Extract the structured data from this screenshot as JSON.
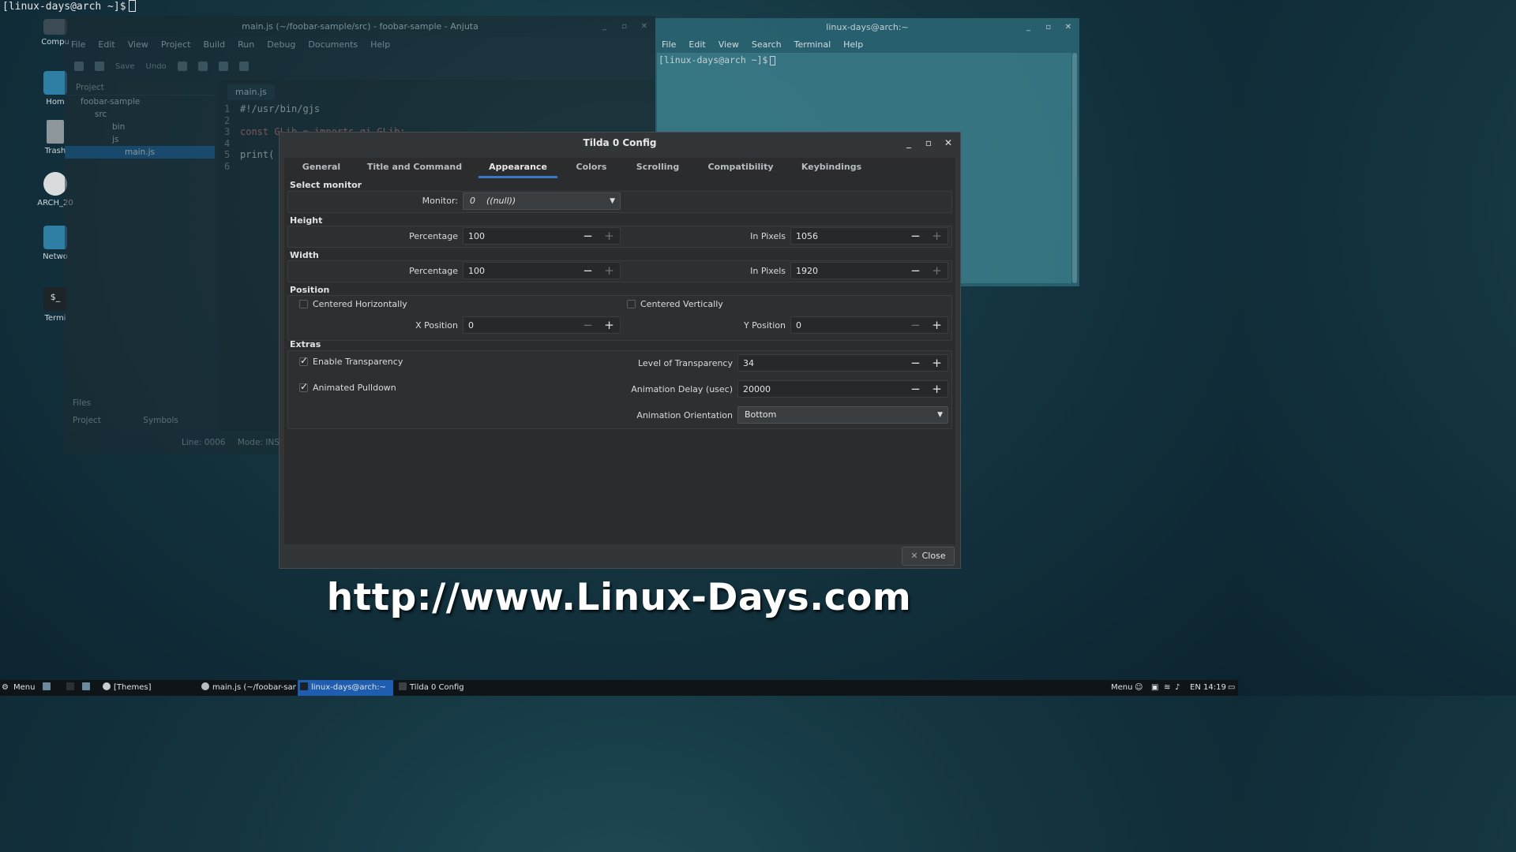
{
  "tilda_prompt": "[linux-days@arch ~]$",
  "desktop_icons": [
    "Compu",
    "Hom",
    "Trash",
    "ARCH_20",
    "Netwo",
    "Termi"
  ],
  "anjuta": {
    "title": "main.js (~/foobar-sample/src) - foobar-sample - Anjuta",
    "menu": [
      "File",
      "Edit",
      "View",
      "Project",
      "Build",
      "Run",
      "Debug",
      "Documents",
      "Help"
    ],
    "toolbar": {
      "save": "Save",
      "undo": "Undo"
    },
    "panel_title": "Project",
    "tree": [
      "foobar-sample",
      "src",
      "bin",
      "js",
      "main.js"
    ],
    "tab": "main.js",
    "code": [
      {
        "n": "1",
        "t": "#!/usr/bin/gjs"
      },
      {
        "n": "2",
        "t": ""
      },
      {
        "n": "3",
        "t": "const GLib = imports.gi.GLib;"
      },
      {
        "n": "4",
        "t": ""
      },
      {
        "n": "5",
        "t": "print("
      },
      {
        "n": "6",
        "t": ""
      }
    ],
    "bottom_panels": {
      "files": "Files",
      "project": "Project",
      "symbols": "Symbols"
    },
    "status_line": "Line: 0006",
    "status_mode": "Mode: INS"
  },
  "terminal": {
    "title": "linux-days@arch:~",
    "menu": [
      "File",
      "Edit",
      "View",
      "Search",
      "Terminal",
      "Help"
    ],
    "prompt": "[linux-days@arch ~]$"
  },
  "dialog": {
    "title": "Tilda 0 Config",
    "tabs": [
      "General",
      "Title and Command",
      "Appearance",
      "Colors",
      "Scrolling",
      "Compatibility",
      "Keybindings"
    ],
    "active_tab": "Appearance",
    "select_monitor": {
      "section": "Select monitor",
      "monitor_label": "Monitor:",
      "monitor_value": "0    ((null))"
    },
    "height": {
      "section": "Height",
      "percentage_label": "Percentage",
      "percentage_value": "100",
      "pixels_label": "In Pixels",
      "pixels_value": "1056"
    },
    "width": {
      "section": "Width",
      "percentage_label": "Percentage",
      "percentage_value": "100",
      "pixels_label": "In Pixels",
      "pixels_value": "1920"
    },
    "position": {
      "section": "Position",
      "centered_h_label": "Centered Horizontally",
      "centered_h_checked": false,
      "centered_v_label": "Centered Vertically",
      "centered_v_checked": false,
      "x_label": "X Position",
      "x_value": "0",
      "y_label": "Y Position",
      "y_value": "0"
    },
    "extras": {
      "section": "Extras",
      "transparency_label": "Enable Transparency",
      "transparency_checked": true,
      "pulldown_label": "Animated Pulldown",
      "pulldown_checked": true,
      "level_label": "Level of Transparency",
      "level_value": "34",
      "delay_label": "Animation Delay (usec)",
      "delay_value": "20000",
      "orientation_label": "Animation Orientation",
      "orientation_value": "Bottom"
    },
    "close_label": "Close"
  },
  "watermark": "http://www.Linux-Days.com",
  "taskbar": {
    "menu": "Menu",
    "themes": "[Themes]",
    "anjuta": "main.js (~/foobar-samp...",
    "terminal": "linux-days@arch:~",
    "tilda": "Tilda 0 Config",
    "right_menu": "Menu",
    "lang": "EN",
    "clock": "14:19"
  },
  "colors": {
    "accent": "#3a78c3",
    "taskbar_active": "#1e5db0",
    "dialog_bg": "#323638"
  }
}
